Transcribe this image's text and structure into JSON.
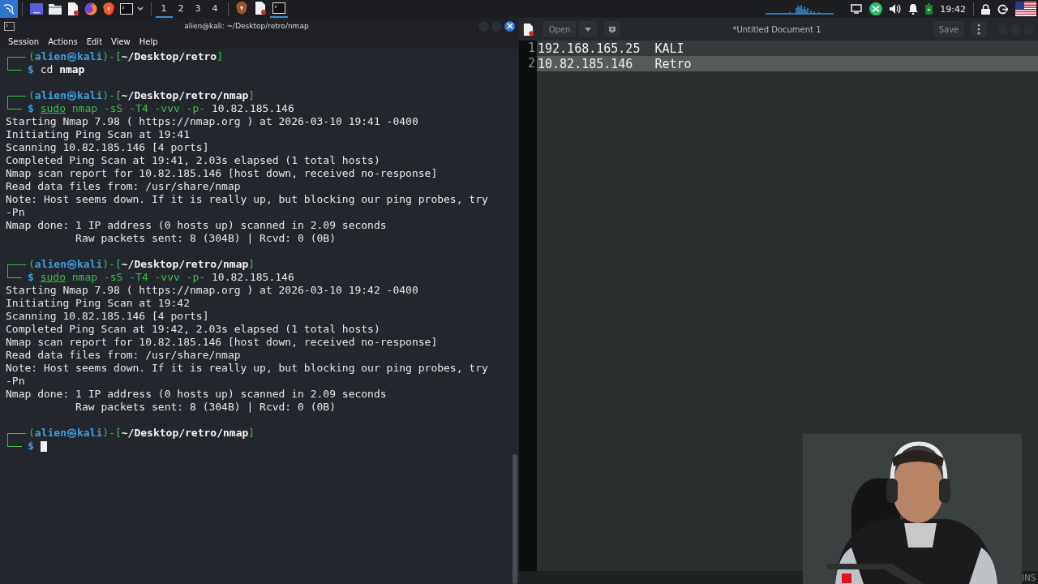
{
  "taskbar": {
    "workspaces": [
      {
        "label": "1",
        "selected": true
      },
      {
        "label": "2",
        "selected": false
      },
      {
        "label": "3",
        "selected": false
      },
      {
        "label": "4",
        "selected": false
      }
    ],
    "windows": [
      {
        "kind": "browser",
        "selected": false
      },
      {
        "kind": "editor",
        "selected": false
      },
      {
        "kind": "terminal",
        "selected": true
      }
    ],
    "clock": "19:42"
  },
  "terminal": {
    "title": "alien@kali: ~/Desktop/retro/nmap",
    "menu": [
      "Session",
      "Actions",
      "Edit",
      "View",
      "Help"
    ],
    "lines": [
      {
        "kind": "prompt",
        "open": "(",
        "user": "alien㉿kali",
        "mid": ")-[",
        "path": "~/Desktop/retro",
        "close": "]",
        "symbol": "$",
        "command": [
          {
            "kind": "plain",
            "text": "cd "
          },
          {
            "kind": "bold",
            "text": "nmap"
          }
        ],
        "cursor": false
      },
      {
        "kind": "blank"
      },
      {
        "kind": "prompt",
        "open": "(",
        "user": "alien㉿kali",
        "mid": ")-[",
        "path": "~/Desktop/retro/nmap",
        "close": "]",
        "symbol": "$",
        "command": [
          {
            "kind": "sudo",
            "text": "sudo"
          },
          {
            "kind": "cmd",
            "text": " nmap -sS -T4 -vvv -p- "
          },
          {
            "kind": "plain",
            "text": "10.82.185.146"
          }
        ],
        "cursor": false
      },
      {
        "kind": "output",
        "text": "Starting Nmap 7.98 ( https://nmap.org ) at 2026-03-10 19:41 -0400"
      },
      {
        "kind": "output",
        "text": "Initiating Ping Scan at 19:41"
      },
      {
        "kind": "output",
        "text": "Scanning 10.82.185.146 [4 ports]"
      },
      {
        "kind": "output",
        "text": "Completed Ping Scan at 19:41, 2.03s elapsed (1 total hosts)"
      },
      {
        "kind": "output",
        "text": "Nmap scan report for 10.82.185.146 [host down, received no-response]"
      },
      {
        "kind": "output",
        "text": "Read data files from: /usr/share/nmap"
      },
      {
        "kind": "output",
        "text": "Note: Host seems down. If it is really up, but blocking our ping probes, try"
      },
      {
        "kind": "output",
        "text": "-Pn"
      },
      {
        "kind": "output",
        "text": "Nmap done: 1 IP address (0 hosts up) scanned in 2.09 seconds"
      },
      {
        "kind": "output",
        "text": "           Raw packets sent: 8 (304B) | Rcvd: 0 (0B)"
      },
      {
        "kind": "blank"
      },
      {
        "kind": "prompt",
        "open": "(",
        "user": "alien㉿kali",
        "mid": ")-[",
        "path": "~/Desktop/retro/nmap",
        "close": "]",
        "symbol": "$",
        "command": [
          {
            "kind": "sudo",
            "text": "sudo"
          },
          {
            "kind": "cmd",
            "text": " nmap -sS -T4 -vvv -p- "
          },
          {
            "kind": "plain",
            "text": "10.82.185.146"
          }
        ],
        "cursor": false
      },
      {
        "kind": "output",
        "text": "Starting Nmap 7.98 ( https://nmap.org ) at 2026-03-10 19:42 -0400"
      },
      {
        "kind": "output",
        "text": "Initiating Ping Scan at 19:42"
      },
      {
        "kind": "output",
        "text": "Scanning 10.82.185.146 [4 ports]"
      },
      {
        "kind": "output",
        "text": "Completed Ping Scan at 19:42, 2.03s elapsed (1 total hosts)"
      },
      {
        "kind": "output",
        "text": "Nmap scan report for 10.82.185.146 [host down, received no-response]"
      },
      {
        "kind": "output",
        "text": "Read data files from: /usr/share/nmap"
      },
      {
        "kind": "output",
        "text": "Note: Host seems down. If it is really up, but blocking our ping probes, try"
      },
      {
        "kind": "output",
        "text": "-Pn"
      },
      {
        "kind": "output",
        "text": "Nmap done: 1 IP address (0 hosts up) scanned in 2.09 seconds"
      },
      {
        "kind": "output",
        "text": "           Raw packets sent: 8 (304B) | Rcvd: 0 (0B)"
      },
      {
        "kind": "blank"
      },
      {
        "kind": "prompt",
        "open": "(",
        "user": "alien㉿kali",
        "mid": ")-[",
        "path": "~/Desktop/retro/nmap",
        "close": "]",
        "symbol": "$",
        "cursor": true
      }
    ]
  },
  "editor": {
    "open_button": "Open",
    "title": "*Untitled Document 1",
    "save_button": "Save",
    "lines": [
      {
        "number": "1",
        "text": "192.168.165.25  KALI",
        "current": false
      },
      {
        "number": "2",
        "text": "10.82.185.146   Retro",
        "current": true
      }
    ],
    "status": "INS"
  }
}
